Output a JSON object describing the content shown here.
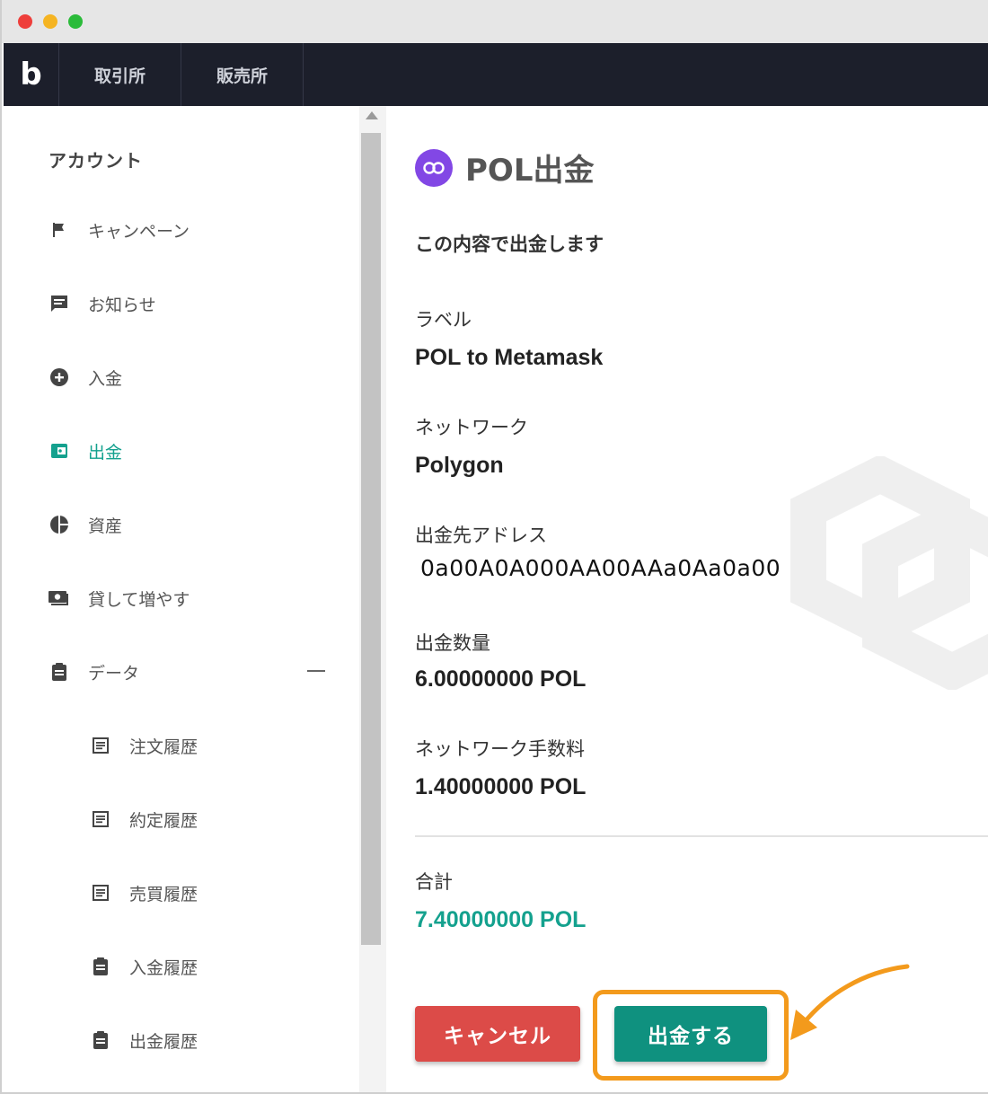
{
  "nav": {
    "logo": "b",
    "tabs": [
      "取引所",
      "販売所"
    ]
  },
  "sidebar": {
    "heading": "アカウント",
    "items": [
      {
        "label": "キャンペーン",
        "icon": "flag-icon"
      },
      {
        "label": "お知らせ",
        "icon": "message-icon"
      },
      {
        "label": "入金",
        "icon": "plus-circle-icon"
      },
      {
        "label": "出金",
        "icon": "wallet-icon",
        "active": true
      },
      {
        "label": "資産",
        "icon": "pie-chart-icon"
      },
      {
        "label": "貸して増やす",
        "icon": "money-icon"
      },
      {
        "label": "データ",
        "icon": "clipboard-icon",
        "expanded": true
      }
    ],
    "sub_items": [
      {
        "label": "注文履歴",
        "icon": "list-icon"
      },
      {
        "label": "約定履歴",
        "icon": "list-icon"
      },
      {
        "label": "売買履歴",
        "icon": "list-icon"
      },
      {
        "label": "入金履歴",
        "icon": "clipboard-icon"
      },
      {
        "label": "出金履歴",
        "icon": "clipboard-icon"
      }
    ]
  },
  "main": {
    "title": "POL出金",
    "confirm_text": "この内容で出金します",
    "fields": {
      "label_title": "ラベル",
      "label_value": "POL to Metamask",
      "network_title": "ネットワーク",
      "network_value": "Polygon",
      "address_title": "出金先アドレス",
      "address_value": "0a00A0A000AA00AAa0Aa0a00",
      "amount_title": "出金数量",
      "amount_value": "6.00000000 POL",
      "fee_title": "ネットワーク手数料",
      "fee_value": "1.40000000 POL",
      "total_title": "合計",
      "total_value": "7.40000000 POL"
    },
    "buttons": {
      "cancel": "キャンセル",
      "submit": "出金する"
    }
  },
  "colors": {
    "accent": "#14a18e",
    "submit": "#0f917f",
    "cancel": "#dc4b48",
    "highlight": "#f39a1c",
    "navbar": "#1c1f2b",
    "coin": "#8247e5"
  }
}
